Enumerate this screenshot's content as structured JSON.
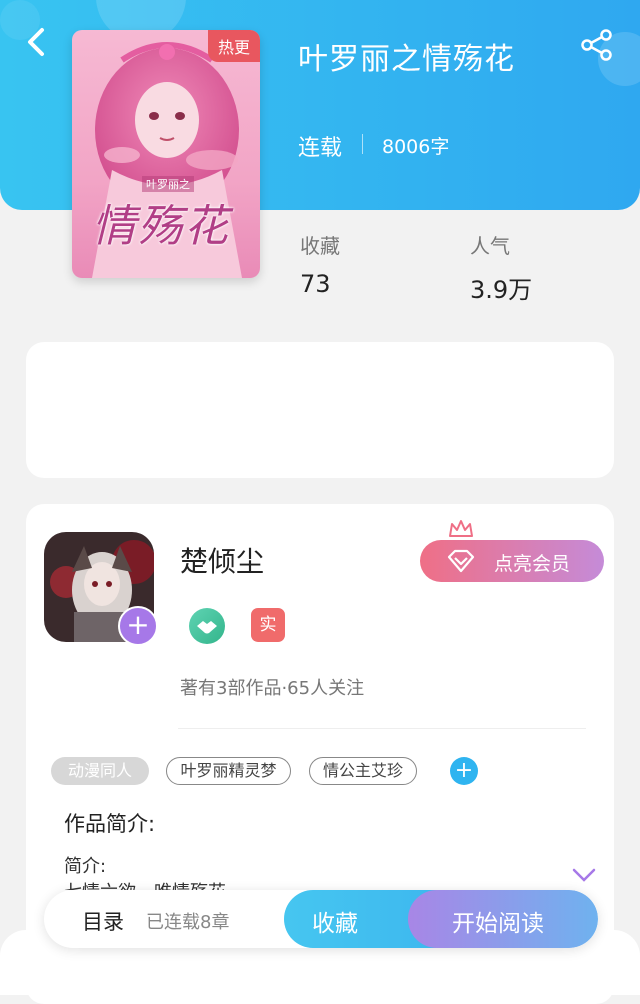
{
  "header": {
    "title": "叶罗丽之情殇花",
    "status": "连载",
    "word_count": "8006字"
  },
  "cover": {
    "tag": "热更",
    "title_art": "情殇花",
    "subtitle_art": "叶罗丽之"
  },
  "stats": [
    {
      "label": "收藏",
      "value": "73"
    },
    {
      "label": "人气",
      "value": "3.9万"
    }
  ],
  "author": {
    "name": "楚倾尘",
    "verified_badge": "实",
    "meta": "著有3部作品·65人关注",
    "follow_icon": "plus-icon",
    "vip_button": "点亮会员"
  },
  "tags": [
    "动漫同人",
    "叶罗丽精灵梦",
    "情公主艾珍"
  ],
  "intro": {
    "title": "作品简介:",
    "label": "简介:",
    "text": "七情六欲，唯情殇花"
  },
  "bottom_bar": {
    "toc": "目录",
    "chapters": "已连载8章",
    "collect": "收藏",
    "read": "开始阅读"
  },
  "colors": {
    "header_blue": "#2fa8f0",
    "hot_tag": "#e8575f",
    "vip_pink": "#ef6f86",
    "accent_purple": "#a678e8"
  }
}
